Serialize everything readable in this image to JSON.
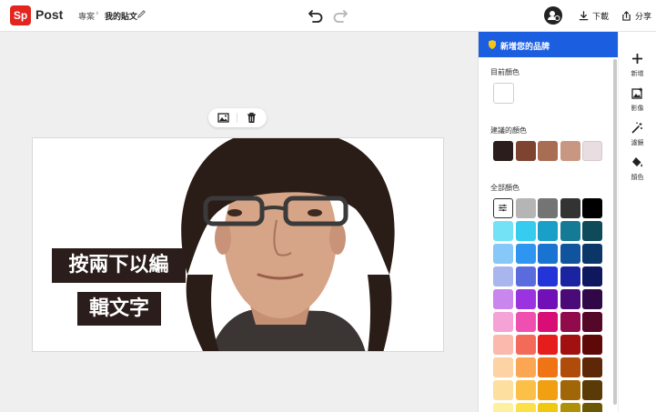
{
  "header": {
    "logo_mark": "Sp",
    "logo_text": "Post",
    "breadcrumb_project": "專案",
    "breadcrumb_separator": "›",
    "breadcrumb_current": "我的貼文",
    "download_label": "下載",
    "share_label": "分享"
  },
  "canvas": {
    "text_line_1": "按兩下以編",
    "text_line_2": "輯文字",
    "text_box_color": "#2a1d1b"
  },
  "panel": {
    "brand_banner": "新增您的品牌",
    "brand_banner_color": "#1b5fe0",
    "current_color_label": "目前顏色",
    "current_color": "#ffffff",
    "suggested_label": "建議的顏色",
    "suggested_colors": [
      "#2a1d1b",
      "#7e4430",
      "#a86d52",
      "#c89782",
      "#e8dde0"
    ],
    "all_colors_label": "全部顏色",
    "all_colors": [
      [
        "custom",
        "#b5b5b5",
        "#747474",
        "#333333",
        "#000000"
      ],
      [
        "#73e2f7",
        "#36ccf0",
        "#1aa0c8",
        "#147a96",
        "#0e4a5a"
      ],
      [
        "#86c8f7",
        "#2e96f0",
        "#1873d1",
        "#0f549c",
        "#0b3768"
      ],
      [
        "#a9b6ee",
        "#5a6cdd",
        "#2335d8",
        "#1a24a0",
        "#0f175e"
      ],
      [
        "#c986ec",
        "#9b33e0",
        "#7210b8",
        "#4a0a78",
        "#300848"
      ],
      [
        "#f5a3d6",
        "#ef4fb0",
        "#d80d76",
        "#900a4c",
        "#550728"
      ],
      [
        "#fbb8ad",
        "#f46a5a",
        "#e51d1d",
        "#a31010",
        "#5e0808"
      ],
      [
        "#fdd2a4",
        "#fba652",
        "#f07314",
        "#b04c0a",
        "#5e2808"
      ],
      [
        "#fde0a0",
        "#fcc048",
        "#f0a010",
        "#a06608",
        "#5a3a06"
      ],
      [
        "#fdf0a0",
        "#fbe048",
        "#f0c810",
        "#b09008",
        "#6a5806"
      ]
    ]
  },
  "rail": {
    "add_label": "新增",
    "image_label": "影像",
    "filter_label": "濾鏡",
    "color_label": "顏色"
  }
}
